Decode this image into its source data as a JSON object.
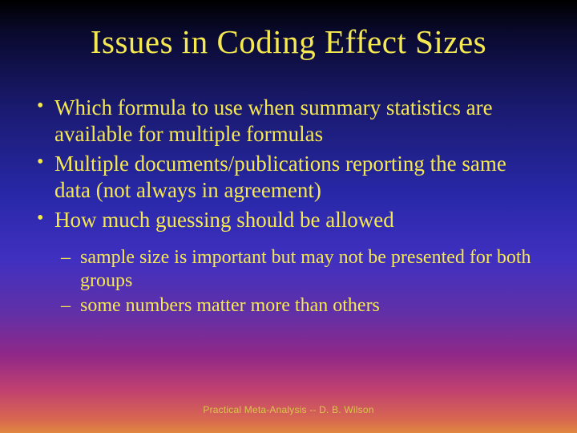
{
  "slide": {
    "title": "Issues in Coding Effect Sizes",
    "bullets": [
      "Which formula to use when summary statistics are available for multiple formulas",
      "Multiple documents/publications reporting the same data (not always in agreement)",
      "How much guessing should be allowed"
    ],
    "sub_bullets": [
      "sample size is important but may not be presented for both groups",
      "some numbers matter more than others"
    ],
    "footer": "Practical Meta-Analysis -- D. B. Wilson"
  }
}
